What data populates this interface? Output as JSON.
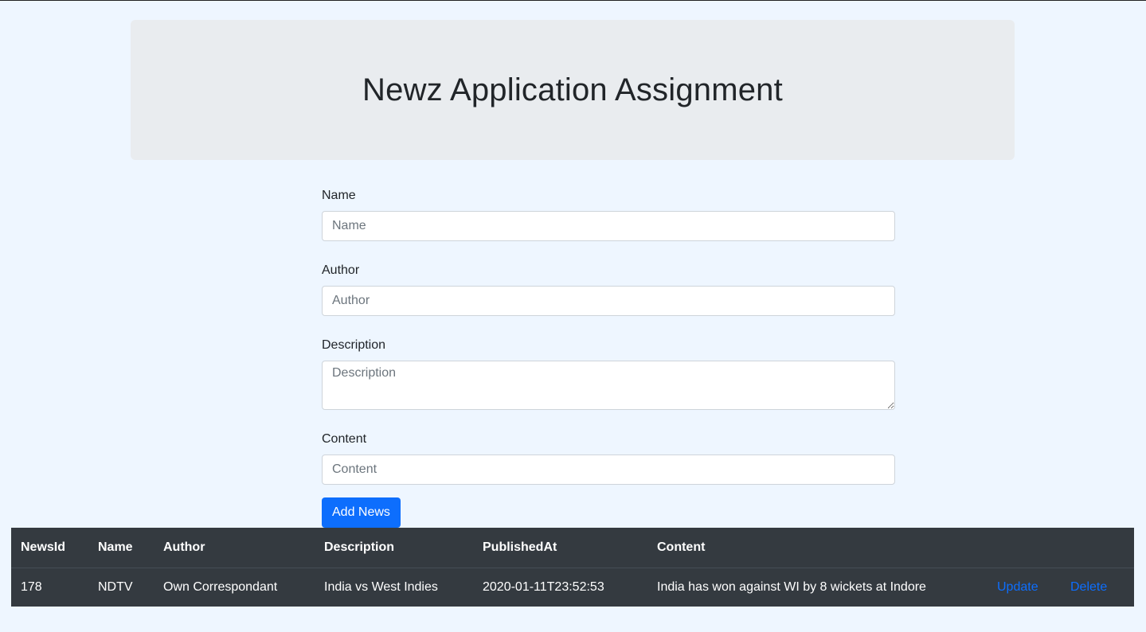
{
  "header": {
    "title": "Newz Application Assignment"
  },
  "form": {
    "name": {
      "label": "Name",
      "placeholder": "Name",
      "value": ""
    },
    "author": {
      "label": "Author",
      "placeholder": "Author",
      "value": ""
    },
    "description": {
      "label": "Description",
      "placeholder": "Description",
      "value": ""
    },
    "content": {
      "label": "Content",
      "placeholder": "Content",
      "value": ""
    },
    "submit_label": "Add News"
  },
  "table": {
    "columns": [
      "NewsId",
      "Name",
      "Author",
      "Description",
      "PublishedAt",
      "Content"
    ],
    "rows": [
      {
        "news_id": "178",
        "name": "NDTV",
        "author": "Own Correspondant",
        "description": "India vs West Indies",
        "published_at": "2020-01-11T23:52:53",
        "content": "India has won against WI by 8 wickets at Indore",
        "update_label": "Update",
        "delete_label": "Delete"
      }
    ]
  },
  "colors": {
    "page_background": "#eef6ff",
    "jumbotron_background": "#e9ecef",
    "primary": "#0d6efd",
    "table_dark": "#343a40"
  }
}
